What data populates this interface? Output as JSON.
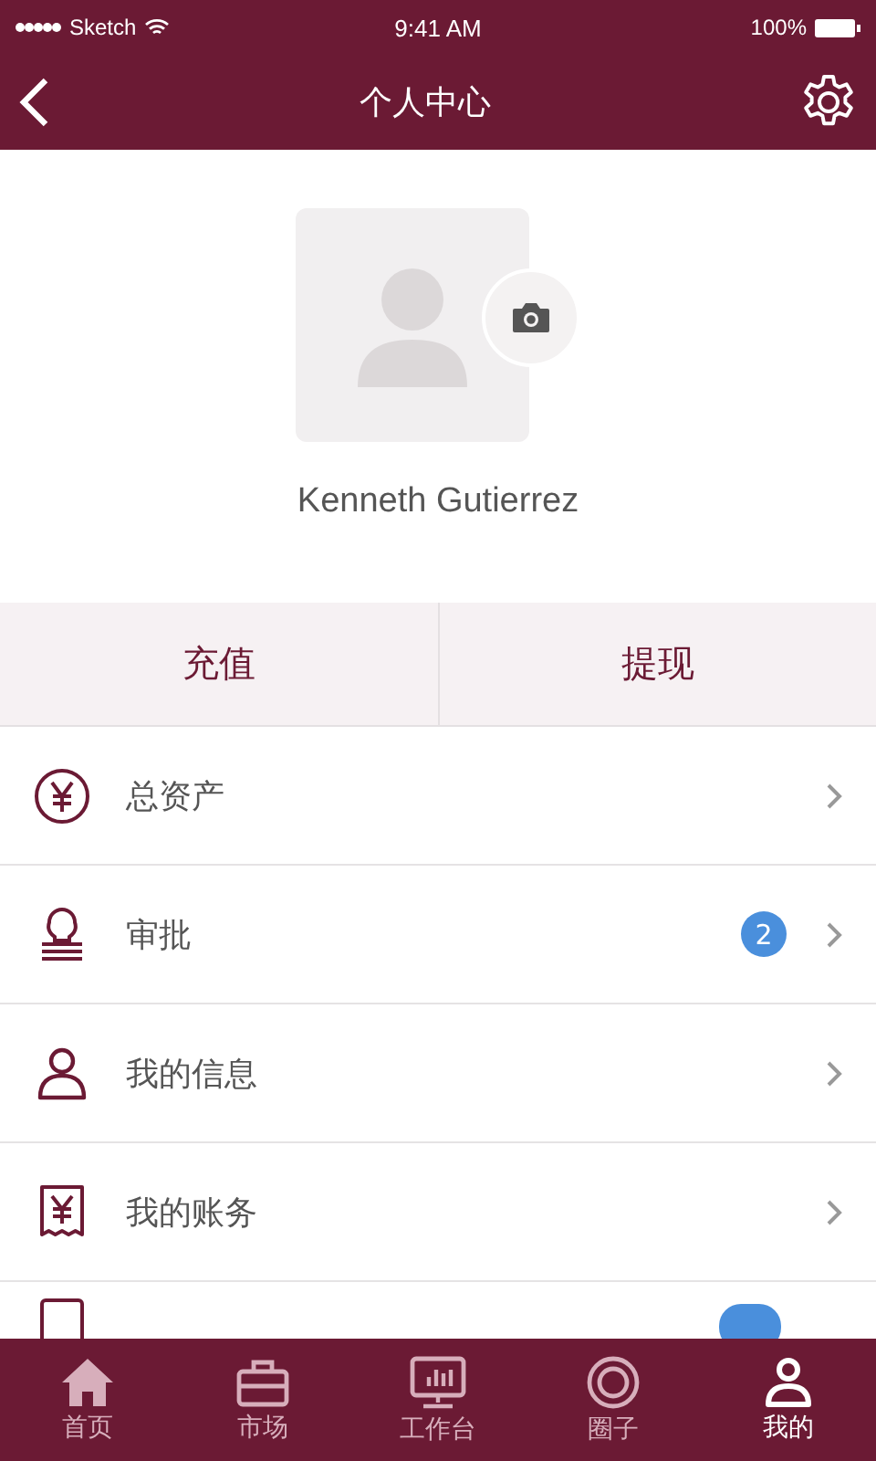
{
  "status_bar": {
    "carrier": "Sketch",
    "time": "9:41 AM",
    "battery": "100%"
  },
  "nav": {
    "title": "个人中心"
  },
  "profile": {
    "name": "Kenneth Gutierrez"
  },
  "actions": [
    {
      "label": "充值"
    },
    {
      "label": "提现"
    }
  ],
  "menu": [
    {
      "kind": "yen",
      "label": "总资产"
    },
    {
      "kind": "stamp",
      "label": "审批",
      "badge": "2"
    },
    {
      "kind": "person",
      "label": "我的信息"
    },
    {
      "kind": "bill",
      "label": "我的账务"
    }
  ],
  "tabs": [
    {
      "kind": "home",
      "label": "首页",
      "selected": false
    },
    {
      "kind": "briefcase",
      "label": "市场",
      "selected": false
    },
    {
      "kind": "monitor",
      "label": "工作台",
      "selected": false
    },
    {
      "kind": "circle",
      "label": "圈子",
      "selected": false
    },
    {
      "kind": "person",
      "label": "我的",
      "selected": true
    }
  ]
}
